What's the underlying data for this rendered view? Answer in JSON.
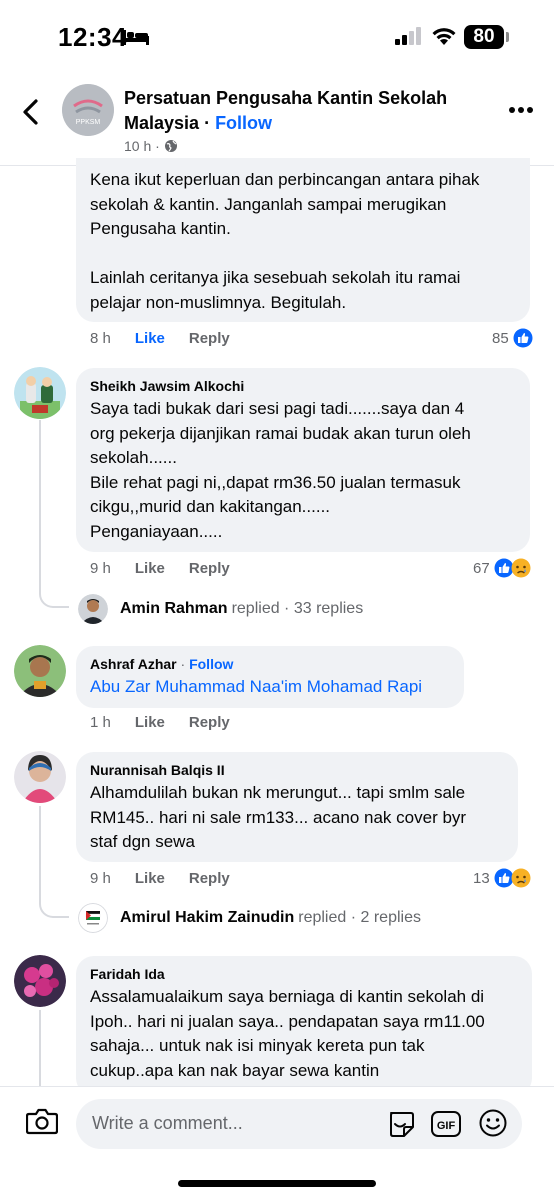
{
  "status": {
    "time": "12:34",
    "battery": "80"
  },
  "header": {
    "page_name": "Persatuan Pengusaha Kantin Sekolah Malaysia",
    "separator": " · ",
    "follow": "Follow",
    "meta_time": "10 h",
    "meta_sep": " · ",
    "avatar_text": "PPKSM"
  },
  "comments": [
    {
      "text_lines": [
        "Kena ikut keperluan dan perbincangan antara pihak",
        "sekolah & kantin. Janganlah sampai merugikan",
        "Pengusaha kantin.",
        "",
        "Lainlah ceritanya jika sesebuah sekolah itu ramai",
        "pelajar non-muslimnya. Begitulah."
      ],
      "time": "8 h",
      "like": "Like",
      "reply": "Reply",
      "reactions": "85"
    },
    {
      "author": "Sheikh Jawsim Alkochi",
      "text_lines": [
        "Saya tadi bukak dari sesi pagi tadi.......saya dan 4",
        "org pekerja dijanjikan ramai budak akan turun oleh",
        "sekolah......",
        "Bile rehat pagi ni,,dapat rm36.50 jualan termasuk",
        "cikgu,,murid dan kakitangan......",
        "Penganiayaan....."
      ],
      "time": "9 h",
      "like": "Like",
      "reply": "Reply",
      "reactions": "67",
      "replied_name": "Amin Rahman",
      "replied_text": "replied · 33 replies"
    },
    {
      "author": "Ashraf Azhar",
      "author_sep": " · ",
      "follow": "Follow",
      "text": "Abu Zar Muhammad Naa'im Mohamad Rapi",
      "time": "1 h",
      "like": "Like",
      "reply": "Reply"
    },
    {
      "author": "Nurannisah Balqis II",
      "text_lines": [
        "Alhamdulilah bukan nk merungut... tapi smlm sale",
        "RM145.. hari ni sale rm133... acano nak cover byr",
        "staf dgn sewa"
      ],
      "time": "9 h",
      "like": "Like",
      "reply": "Reply",
      "reactions": "13",
      "replied_name": "Amirul Hakim Zainudin",
      "replied_text": "replied · 2 replies"
    },
    {
      "author": "Faridah Ida",
      "text_lines": [
        "Assalamualaikum saya berniaga di kantin sekolah di",
        "Ipoh.. hari ni jualan saya.. pendapatan saya rm11.00",
        "sahaja... untuk nak isi minyak kereta pun tak",
        "cukup..apa kan nak bayar sewa kantin"
      ]
    }
  ],
  "composer": {
    "placeholder": "Write a comment...",
    "gif": "GIF"
  },
  "colors": {
    "accent": "#0866ff",
    "bubble": "#f0f2f5",
    "muted": "#65676b"
  },
  "icons": [
    "bed-icon",
    "signal-icon",
    "wifi-icon",
    "back-icon",
    "more-icon",
    "globe-icon",
    "like-reaction-icon",
    "sad-reaction-icon",
    "camera-icon",
    "sticker-icon",
    "gif-icon",
    "emoji-icon"
  ]
}
